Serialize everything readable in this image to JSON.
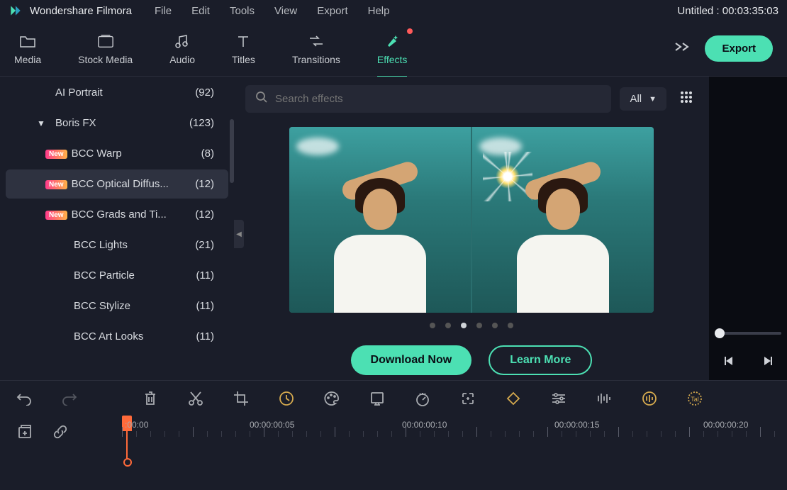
{
  "app": {
    "title": "Wondershare Filmora",
    "project": "Untitled : 00:03:35:03"
  },
  "menu": [
    "File",
    "Edit",
    "Tools",
    "View",
    "Export",
    "Help"
  ],
  "tabs": [
    {
      "label": "Media"
    },
    {
      "label": "Stock Media"
    },
    {
      "label": "Audio"
    },
    {
      "label": "Titles"
    },
    {
      "label": "Transitions"
    },
    {
      "label": "Effects",
      "active": true,
      "dot": true
    }
  ],
  "export_label": "Export",
  "search": {
    "placeholder": "Search effects"
  },
  "filter": {
    "label": "All"
  },
  "sidebar": [
    {
      "label": "AI Portrait",
      "count": "(92)",
      "lvl": 1
    },
    {
      "label": "Boris FX",
      "count": "(123)",
      "lvl": 1,
      "expanded": true
    },
    {
      "label": "BCC Warp",
      "count": "(8)",
      "lvl": 2,
      "new": true
    },
    {
      "label": "BCC Optical Diffus...",
      "count": "(12)",
      "lvl": 2,
      "new": true,
      "selected": true
    },
    {
      "label": "BCC Grads and Ti...",
      "count": "(12)",
      "lvl": 2,
      "new": true
    },
    {
      "label": "BCC Lights",
      "count": "(21)",
      "lvl": 3
    },
    {
      "label": "BCC Particle",
      "count": "(11)",
      "lvl": 3
    },
    {
      "label": "BCC Stylize",
      "count": "(11)",
      "lvl": 3
    },
    {
      "label": "BCC Art Looks",
      "count": "(11)",
      "lvl": 3
    }
  ],
  "carousel": {
    "dots": 6,
    "active_dot": 2,
    "download": "Download Now",
    "learn": "Learn More"
  },
  "badge_text": "New",
  "timeline": {
    "labels": [
      {
        "text": ":00:00",
        "pos": 0
      },
      {
        "text": "00:00:00:05",
        "pos": 180
      },
      {
        "text": "00:00:00:10",
        "pos": 395
      },
      {
        "text": "00:00:00:15",
        "pos": 610
      },
      {
        "text": "00:00:00:20",
        "pos": 820
      }
    ]
  }
}
